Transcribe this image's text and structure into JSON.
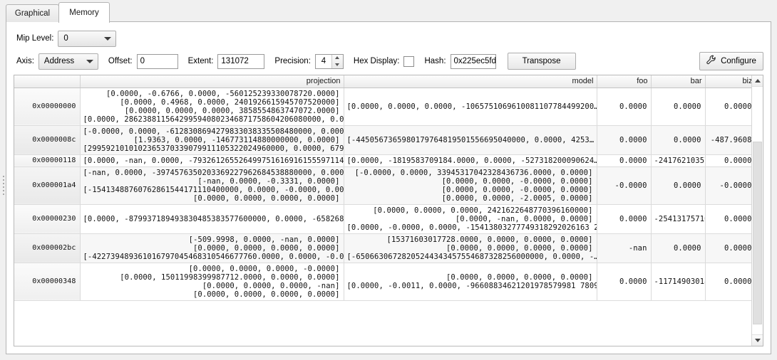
{
  "tabs": [
    {
      "label": "Graphical",
      "selected": false
    },
    {
      "label": "Memory",
      "selected": true
    }
  ],
  "toolbar": {
    "mip_level_label": "Mip Level:",
    "mip_level_value": "0",
    "axis_label": "Axis:",
    "axis_value": "Address",
    "offset_label": "Offset:",
    "offset_value": "0",
    "extent_label": "Extent:",
    "extent_value": "131072",
    "precision_label": "Precision:",
    "precision_value": "4",
    "hex_display_label": "Hex Display:",
    "hex_display_checked": false,
    "hash_label": "Hash:",
    "hash_value": "0x225ec5fd",
    "transpose_label": "Transpose",
    "configure_label": "Configure",
    "configure_icon": "wrench-icon"
  },
  "table": {
    "columns": [
      "projection",
      "model",
      "foo",
      "bar",
      "biz"
    ],
    "rows": [
      {
        "address": "0x00000000",
        "projection": "              [0.0000, -0.6766, 0.0000, -560125239330078720.0000]\n                [0.0000, 0.4968, 0.0000, 2401926615945707520000]\n                 [0.0000, 0.0000, 0.0000, 3858554863747072.0000]\n[0.0000, 2862388115642995940802346871758604206080000, 0.00…",
        "projection_lines": [
          "[0.0000, -0.6766, 0.0000, -560125239330078720.0000]",
          "[0.0000, 0.4968, 0.0000, 2401926615945707520000]",
          "[0.0000, 0.0000, 0.0000, 3858554863747072.0000]",
          "[0.0000, 2862388115642995940802346871758604206080000, 0.00…"
        ],
        "model_lines": [
          "[0.0000, 0.0000, 0.0000, -1065751069610081107784499200…"
        ],
        "foo": "0.0000",
        "bar": "0.0000",
        "biz": "0.0000"
      },
      {
        "address": "0x0000008c",
        "projection_lines": [
          "[-0.0000, 0.0000, -6128308694279833038335508480000, 0.0000]",
          "[1.9363, 0.0000, -146773114880000000, 0.0000]",
          "[2995921010102365370339079911105322024960000, 0.0000, 6792…"
        ],
        "model_lines": [
          "[-4450567365980179764819501556695040000, 0.0000, 4253…"
        ],
        "foo": "0.0000",
        "bar": "0.0000",
        "biz": "-487.9608"
      },
      {
        "address": "0x00000118",
        "projection_lines": [
          "[0.0000, -nan, 0.0000, -79326126552649975161691615559711457…"
        ],
        "model_lines": [
          "[0.0000, -1819583709184.0000, 0.0000, -527318200090624…"
        ],
        "foo": "0.0000",
        "bar": "-24176210357…",
        "biz": "0.0000"
      },
      {
        "address": "0x000001a4",
        "projection_lines": [
          "[-nan, 0.0000, -3974576350203369227962684538880000, 0.0000]",
          "[-nan, 0.0000, -0.3331, 0.0000]",
          "[-15413488760762861544171110400000, 0.0000, -0.0000, 0.0000]",
          "[0.0000, 0.0000, 0.0000, 0.0000]"
        ],
        "model_lines": [
          "[-0.0000, 0.0000, 33945317042328436736.0000, 0.0000]",
          "[0.0000, 0.0000, -0.0000, 0.0000]",
          "[0.0000, 0.0000, -0.0000, 0.0000]",
          "[0.0000, 0.0000, -2.0005, 0.0000]"
        ],
        "foo": "-0.0000",
        "bar": "0.0000",
        "biz": "-0.0000"
      },
      {
        "address": "0x00000230",
        "projection_lines": [
          "[0.0000, -879937189493830485383577600000, 0.0000, -65826897…"
        ],
        "model_lines": [
          "[0.0000, 0.0000, 0.0000, 2421622648770396160000]",
          "[0.0000, -nan, 0.0000, 0.0000]",
          "[0.0000, -0.0000, 0.0000, -15413803277749318292026163 2…"
        ],
        "foo": "0.0000",
        "bar": "-25413175716…",
        "biz": "0.0000"
      },
      {
        "address": "0x000002bc",
        "projection_lines": [
          "[-509.9998, 0.0000, -nan, 0.0000]",
          "[0.0000, 0.0000, 0.0000, 0.0000]",
          "[-422739489361016797045468310546677760.0000, 0.0000, -0.000…"
        ],
        "model_lines": [
          "[15371603017728.0000, 0.0000, 0.0000, 0.0000]",
          "[0.0000, 0.0000, 0.0000, 0.0000]",
          "[-65066306728205244343457554687328256000000, 0.0000, -…"
        ],
        "foo": "-nan",
        "bar": "0.0000",
        "biz": "0.0000"
      },
      {
        "address": "0x00000348",
        "projection_lines": [
          "[0.0000, 0.0000, 0.0000, -0.0000]",
          "[0.0000, 15011998399987712.0000, 0.0000, 0.0000]",
          "[0.0000, 0.0000, 0.0000, -nan]",
          "[0.0000, 0.0000, 0.0000, 0.0000]"
        ],
        "model_lines": [
          "[0.0000, 0.0000, 0.0000, 0.0000]",
          "[0.0000, -0.0011, 0.0000, -96608834621201978579981 7809…"
        ],
        "foo": "0.0000",
        "bar": "-11714903018…",
        "biz": "0.0000"
      }
    ]
  },
  "scrollbar": {
    "up_icon": "triangle-up-icon",
    "down_icon": "triangle-down-icon"
  }
}
